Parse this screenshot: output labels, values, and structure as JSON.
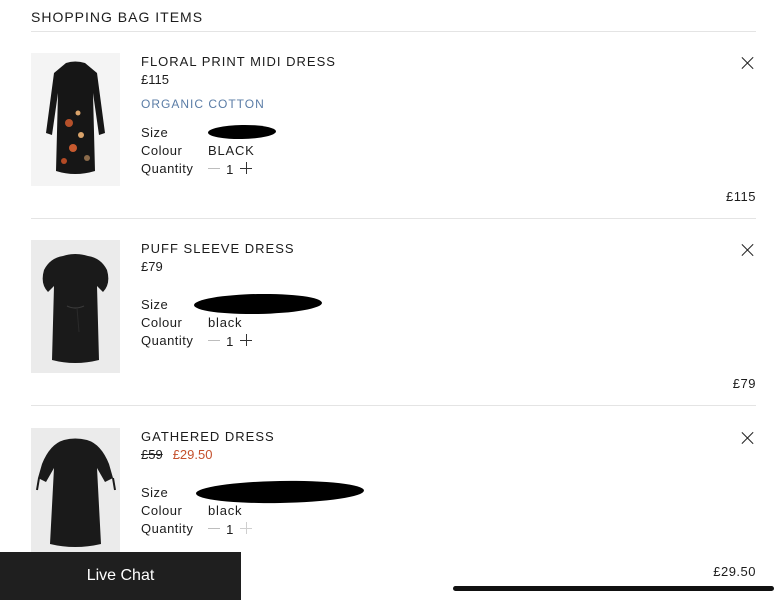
{
  "page": {
    "section_title": "SHOPPING BAG ITEMS"
  },
  "labels": {
    "size": "Size",
    "colour": "Colour",
    "quantity": "Quantity"
  },
  "items": [
    {
      "name": "FLORAL PRINT MIDI DRESS",
      "price": "£115",
      "tag": "ORGANIC COTTON",
      "colour": "BLACK",
      "quantity": "1",
      "total": "£115"
    },
    {
      "name": "PUFF SLEEVE DRESS",
      "price": "£79",
      "colour": "black",
      "quantity": "1",
      "total": "£79"
    },
    {
      "name": "GATHERED DRESS",
      "original_price": "£59",
      "sale_price": "£29.50",
      "colour": "black",
      "quantity": "1",
      "total": "£29.50"
    }
  ],
  "chat": {
    "label": "Live Chat"
  },
  "colors": {
    "sale": "#c4502c",
    "tag": "#5a7ca6",
    "chat_bg": "#1f1f1f"
  },
  "icons": [
    "close-icon",
    "minus-icon",
    "plus-icon"
  ]
}
